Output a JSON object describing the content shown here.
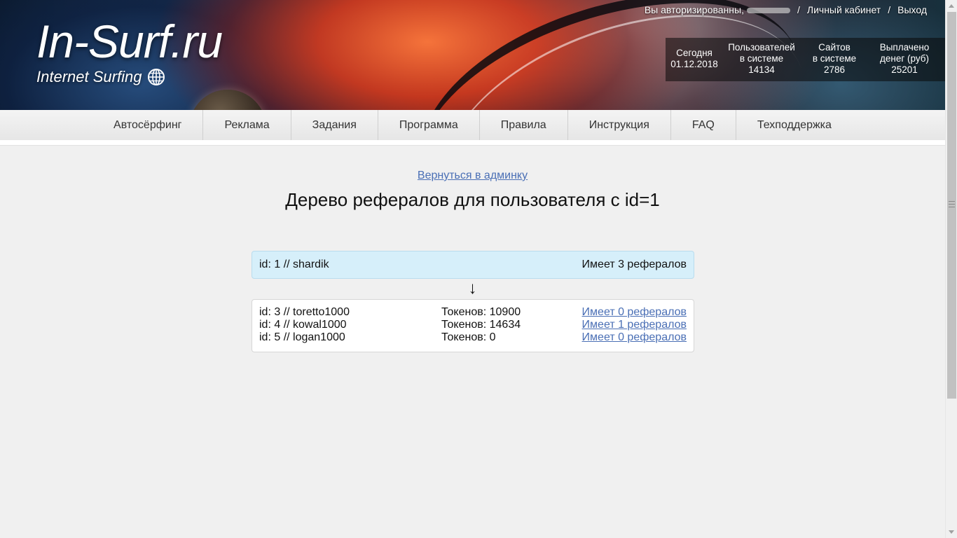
{
  "header": {
    "logo_title": "In-Surf.ru",
    "logo_subtitle": "Internet Surfing",
    "auth_text": "Вы авторизированны,",
    "separator": "/",
    "cabinet_link": "Личный кабинет",
    "logout_link": "Выход",
    "stats": [
      {
        "line1": "Сегодня",
        "line2": "01.12.2018",
        "line3": ""
      },
      {
        "line1": "Пользователей",
        "line2": "в системе",
        "line3": "14134"
      },
      {
        "line1": "Сайтов",
        "line2": "в системе",
        "line3": "2786"
      },
      {
        "line1": "Выплачено",
        "line2": "денег (руб)",
        "line3": "25201"
      }
    ]
  },
  "nav": {
    "items": [
      "Автосёрфинг",
      "Реклама",
      "Задания",
      "Программа",
      "Правила",
      "Инструкция",
      "FAQ",
      "Техподдержка"
    ]
  },
  "content": {
    "back_link": "Вернуться в админку",
    "title": "Дерево рефералов для пользователя с id=1",
    "root": {
      "label": "id: 1 // shardik",
      "referrals": "Имеет 3 рефералов"
    },
    "arrow": "↓",
    "children": [
      {
        "user": "id: 3 // toretto1000",
        "tokens": "Токенов: 10900",
        "link": "Имеет 0 рефералов"
      },
      {
        "user": "id: 4 // kowal1000",
        "tokens": "Токенов: 14634",
        "link": "Имеет 1 рефералов"
      },
      {
        "user": "id: 5 // logan1000",
        "tokens": "Токенов: 0",
        "link": "Имеет 0 рефералов"
      }
    ]
  },
  "colors": {
    "link": "#4a6fb5",
    "root_box_bg": "#d6effa",
    "page_bg": "#f0f0f0"
  }
}
